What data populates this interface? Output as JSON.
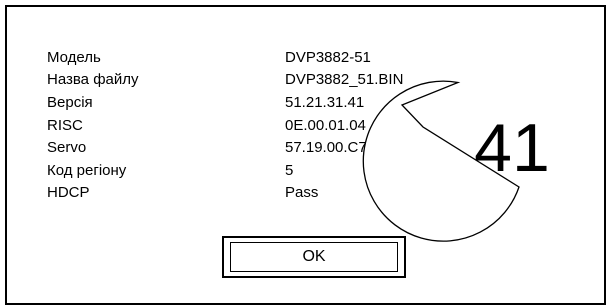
{
  "info": {
    "rows": [
      {
        "label": "Модель",
        "value": "DVP3882-51"
      },
      {
        "label": "Назва файлу",
        "value": "DVP3882_51.BIN"
      },
      {
        "label": "Версія",
        "value": "51.21.31.41"
      },
      {
        "label": "RISC",
        "value": "0E.00.01.04"
      },
      {
        "label": "Servo",
        "value": "57.19.00.C7"
      },
      {
        "label": "Код регіону",
        "value": "5"
      },
      {
        "label": "HDCP",
        "value": "Pass"
      }
    ]
  },
  "ok_button": {
    "label": "OK"
  },
  "zoom_callout": {
    "value": "41"
  },
  "colors": {
    "line": "#000000",
    "background": "#ffffff"
  }
}
